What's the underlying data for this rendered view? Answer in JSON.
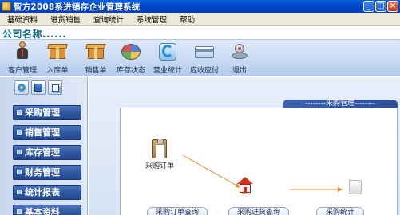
{
  "window": {
    "title": "智方2008系进销存企业管理系统",
    "minimize_label": "_",
    "maximize_label": "□",
    "close_label": "×"
  },
  "menu": {
    "items": [
      "基础资料",
      "进货销售",
      "查询统计",
      "系统管理",
      "帮助"
    ]
  },
  "company": {
    "name": "公司名称......"
  },
  "toolbar": {
    "items": [
      {
        "label": "客户管理",
        "icon": "customer-icon"
      },
      {
        "label": "入库单",
        "icon": "box-icon"
      },
      {
        "label": "销售单",
        "icon": "box-icon"
      },
      {
        "label": "库存状态",
        "icon": "pie-chart-icon"
      },
      {
        "label": "营业统计",
        "icon": "statistics-icon"
      },
      {
        "label": "应收应付",
        "icon": "card-icon"
      },
      {
        "label": "退出",
        "icon": "exit-icon"
      }
    ]
  },
  "sidebar": {
    "items": [
      {
        "label": "采购管理"
      },
      {
        "label": "销售管理"
      },
      {
        "label": "库存管理"
      },
      {
        "label": "财务管理"
      },
      {
        "label": "统计报表"
      },
      {
        "label": "基本资料"
      }
    ]
  },
  "main": {
    "panel_tab": "--------采购管理--------",
    "flow": {
      "purchase_order_label": "采购订单"
    },
    "bottom_buttons": [
      "采购订单查询",
      "采购进货查询",
      "采购统计"
    ]
  },
  "colors": {
    "titlebar": "#0046c8",
    "company_text": "#0e6f86",
    "sidebar_button": "#2f57a0",
    "flow_arrow": "#e8892a",
    "house_roof": "#d3311f"
  }
}
